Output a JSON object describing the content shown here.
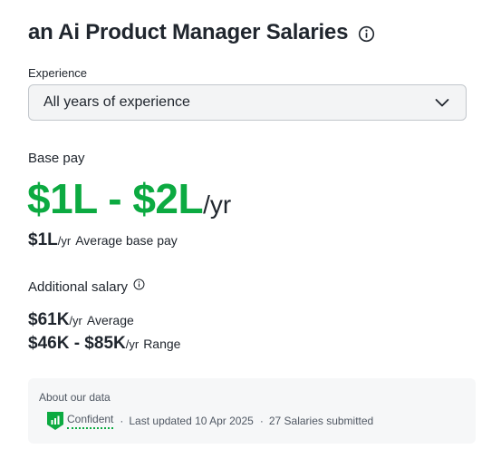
{
  "header": {
    "title": "an Ai Product Manager Salaries"
  },
  "experience": {
    "label": "Experience",
    "selected": "All years of experience"
  },
  "base_pay": {
    "label": "Base pay",
    "range": "$1L - $2L",
    "range_unit": "/yr",
    "average_value": "$1L",
    "average_unit": "/yr",
    "average_label": "Average base pay"
  },
  "additional_salary": {
    "label": "Additional salary",
    "average_value": "$61K",
    "average_unit": "/yr",
    "average_label": "Average",
    "range_value": "$46K - $85K",
    "range_unit": "/yr",
    "range_label": "Range"
  },
  "about_data": {
    "title": "About our data",
    "confidence": "Confident",
    "separator": "·",
    "last_updated": "Last updated 10 Apr 2025",
    "salaries_submitted": "27 Salaries submitted"
  },
  "colors": {
    "accent_green": "#0caa41",
    "text": "#20262e",
    "muted": "#505863"
  }
}
